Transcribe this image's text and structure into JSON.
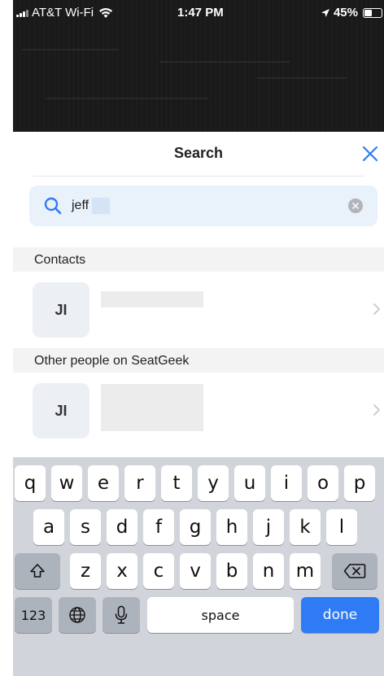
{
  "status_bar": {
    "carrier": "AT&T Wi-Fi",
    "time": "1:47 PM",
    "battery": "45%",
    "battery_level": 0.45
  },
  "sheet": {
    "title": "Search",
    "close_icon": "close-icon"
  },
  "search": {
    "query": "jeff",
    "search_icon": "search-icon",
    "clear_icon": "clear-icon"
  },
  "sections": {
    "contacts": "Contacts",
    "other": "Other people on SeatGeek"
  },
  "results": [
    {
      "initials": "JI"
    },
    {
      "initials": "JI"
    }
  ],
  "keyboard": {
    "row1": [
      "q",
      "w",
      "e",
      "r",
      "t",
      "y",
      "u",
      "i",
      "o",
      "p"
    ],
    "row2": [
      "a",
      "s",
      "d",
      "f",
      "g",
      "h",
      "j",
      "k",
      "l"
    ],
    "row3": [
      "z",
      "x",
      "c",
      "v",
      "b",
      "n",
      "m"
    ],
    "numbers_key": "123",
    "space_key": "space",
    "done_key": "done"
  },
  "colors": {
    "accent": "#2f7bf5",
    "search_bg": "#e9f1fb",
    "section_bg": "#f3f3f3",
    "keyboard_bg": "#d1d4da"
  }
}
